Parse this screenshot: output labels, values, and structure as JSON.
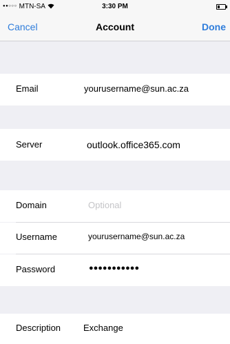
{
  "status_bar": {
    "signal_dots": "●●○○○",
    "carrier": "MTN-SA",
    "wifi_icon": "wifi-icon",
    "time": "3:30 PM",
    "battery_icon": "battery-icon"
  },
  "nav": {
    "cancel_label": "Cancel",
    "title": "Account",
    "done_label": "Done"
  },
  "email": {
    "label": "Email",
    "value": "yourusername@sun.ac.za"
  },
  "server": {
    "label": "Server",
    "value": "outlook.office365.com"
  },
  "domain": {
    "label": "Domain",
    "placeholder": "Optional"
  },
  "username": {
    "label": "Username",
    "value": "yourusername@sun.ac.za"
  },
  "password": {
    "label": "Password",
    "value": "●●●●●●●●●●●"
  },
  "description": {
    "label": "Description",
    "value": "Exchange"
  },
  "colors": {
    "accent": "#2f7ddb",
    "background": "#efeff4",
    "placeholder": "#c4c4c7"
  }
}
